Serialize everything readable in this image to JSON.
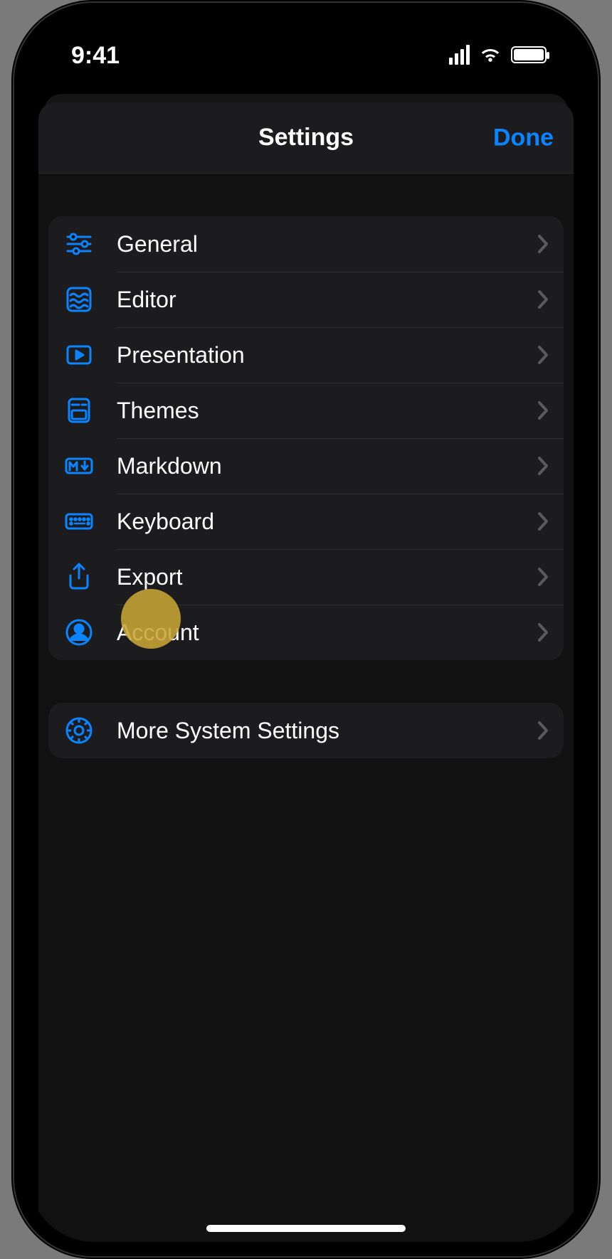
{
  "status": {
    "time": "9:41"
  },
  "nav": {
    "title": "Settings",
    "done": "Done"
  },
  "colors": {
    "accent": "#0a84ff"
  },
  "group1": {
    "items": [
      {
        "label": "General",
        "icon": "sliders-icon"
      },
      {
        "label": "Editor",
        "icon": "wave-box-icon"
      },
      {
        "label": "Presentation",
        "icon": "play-box-icon"
      },
      {
        "label": "Themes",
        "icon": "theme-icon"
      },
      {
        "label": "Markdown",
        "icon": "markdown-icon"
      },
      {
        "label": "Keyboard",
        "icon": "keyboard-icon"
      },
      {
        "label": "Export",
        "icon": "share-icon"
      },
      {
        "label": "Account",
        "icon": "account-icon"
      }
    ]
  },
  "group2": {
    "items": [
      {
        "label": "More System Settings",
        "icon": "gear-icon"
      }
    ]
  },
  "highlight": {
    "row_index": 5
  }
}
